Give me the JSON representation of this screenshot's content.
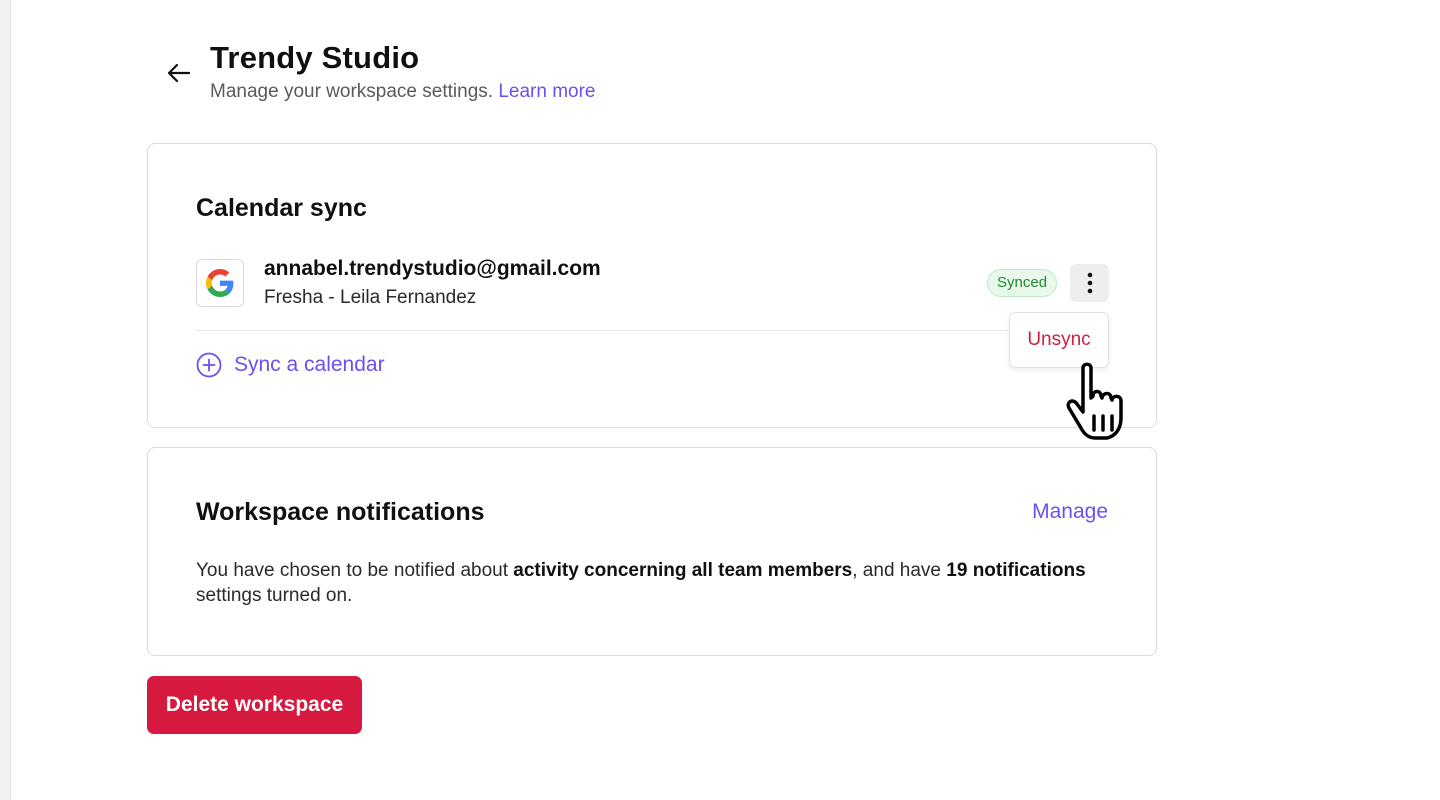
{
  "header": {
    "title": "Trendy Studio",
    "subtitle": "Manage your workspace settings.",
    "learn_more": "Learn more"
  },
  "calendar_sync": {
    "title": "Calendar sync",
    "account": {
      "provider_icon": "google-icon",
      "email": "annabel.trendystudio@gmail.com",
      "name": "Fresha - Leila Fernandez",
      "status": "Synced"
    },
    "menu": {
      "items": [
        "Unsync"
      ]
    },
    "add_label": "Sync a calendar"
  },
  "notifications": {
    "title": "Workspace notifications",
    "manage_label": "Manage",
    "text_1": "You have chosen to be notified about ",
    "bold_1": "activity concerning all team members",
    "text_2": ", and have ",
    "bold_2": "19 notifications",
    "text_3": " settings turned on."
  },
  "actions": {
    "delete_label": "Delete workspace"
  },
  "colors": {
    "accent": "#6950f3",
    "danger": "#d6193e",
    "success_text": "#1f8a34",
    "success_bg": "#e8f8ea"
  }
}
